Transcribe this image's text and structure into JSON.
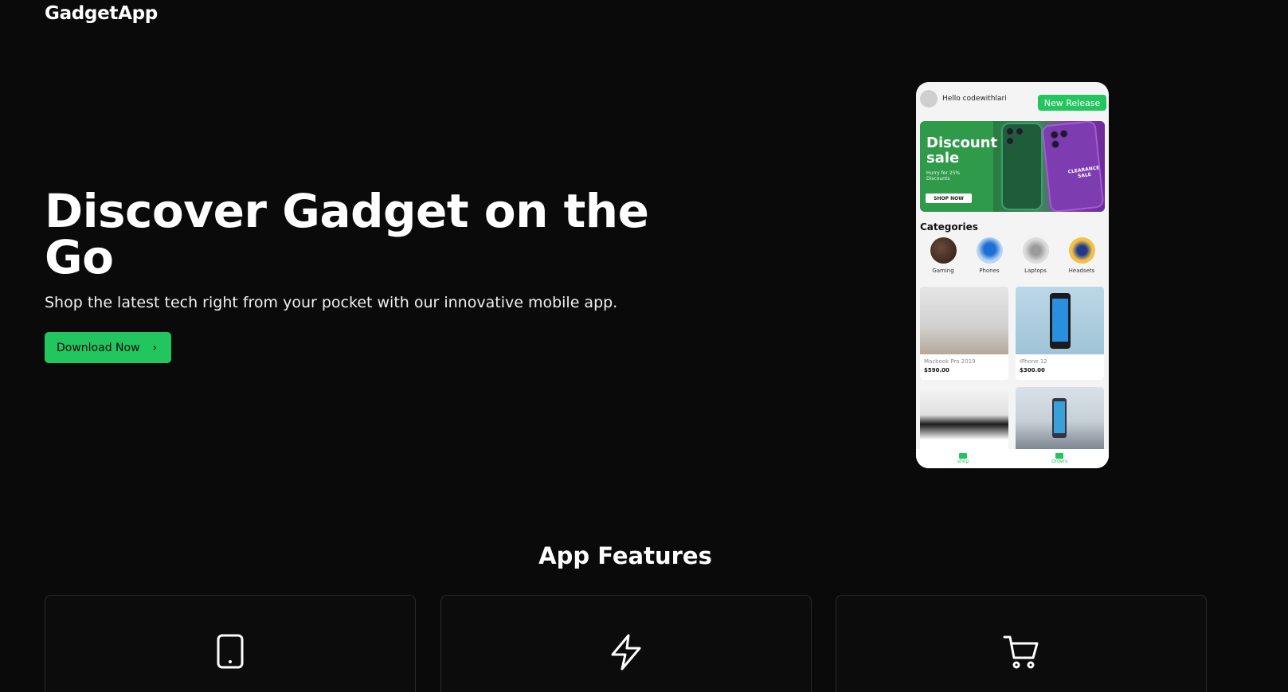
{
  "header": {
    "brand": "GadgetApp"
  },
  "hero": {
    "title": "Discover Gadget on the Go",
    "subtitle": "Shop the latest tech right from your pocket with our innovative mobile app.",
    "cta_label": "Download Now",
    "cta_icon": "chevron-right-icon",
    "accent_color": "#22c55e"
  },
  "phone": {
    "greeting": "Hello codewithlari",
    "badge": "New Release",
    "banner": {
      "title": "Discount sale",
      "small": "Hurry for 25% Discounts",
      "button": "SHOP NOW",
      "tag": "CLEARANCE SALE"
    },
    "categories_title": "Categories",
    "categories": [
      {
        "label": "Gaming"
      },
      {
        "label": "Phones"
      },
      {
        "label": "Laptops"
      },
      {
        "label": "Headsets"
      }
    ],
    "products": [
      {
        "name": "Macbook Pro 2019",
        "price": "$590.00"
      },
      {
        "name": "iPhone 12",
        "price": "$300.00"
      }
    ],
    "tabs": [
      {
        "label": "shop"
      },
      {
        "label": "Orders"
      }
    ]
  },
  "features": {
    "title": "App Features",
    "cards": [
      {
        "icon": "smartphone-icon"
      },
      {
        "icon": "lightning-icon"
      },
      {
        "icon": "shopping-cart-icon"
      }
    ]
  }
}
